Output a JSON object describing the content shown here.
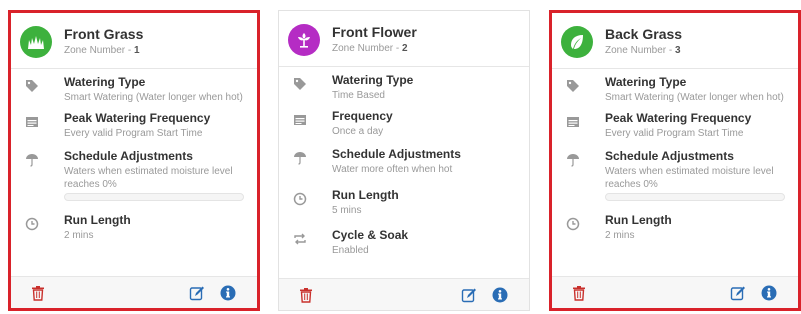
{
  "colors": {
    "selection_border": "#d9222a",
    "info_blue": "#2a6db5",
    "trash_red": "#c9302c",
    "icon_gray": "#999999"
  },
  "cards": [
    {
      "name": "Front Grass",
      "zone_label": "Zone Number - ",
      "zone_number": "1",
      "icon": "grass-icon",
      "icon_color": "#3db13d",
      "selected": true,
      "rows": [
        {
          "icon": "tag-icon",
          "title": "Watering Type",
          "value": "Smart Watering (Water longer when hot)"
        },
        {
          "icon": "calendar-icon",
          "title": "Peak Watering Frequency",
          "value": "Every valid Program Start Time"
        },
        {
          "icon": "umbrella-icon",
          "title": "Schedule Adjustments",
          "value": "Waters when estimated moisture level reaches 0%",
          "progress": 0
        },
        {
          "icon": "clock-icon",
          "title": "Run Length",
          "value": "2 mins"
        }
      ]
    },
    {
      "name": "Front Flower",
      "zone_label": "Zone Number - ",
      "zone_number": "2",
      "icon": "flower-icon",
      "icon_color": "#b52cc4",
      "selected": false,
      "rows": [
        {
          "icon": "tag-icon",
          "title": "Watering Type",
          "value": "Time Based"
        },
        {
          "icon": "calendar-icon",
          "title": "Frequency",
          "value": "Once a day"
        },
        {
          "icon": "umbrella-icon",
          "title": "Schedule Adjustments",
          "value": "Water more often when hot"
        },
        {
          "icon": "clock-icon",
          "title": "Run Length",
          "value": "5 mins"
        },
        {
          "icon": "cycle-icon",
          "title": "Cycle & Soak",
          "value": "Enabled"
        }
      ]
    },
    {
      "name": "Back Grass",
      "zone_label": "Zone Number - ",
      "zone_number": "3",
      "icon": "leaf-icon",
      "icon_color": "#3db13d",
      "selected": true,
      "rows": [
        {
          "icon": "tag-icon",
          "title": "Watering Type",
          "value": "Smart Watering (Water longer when hot)"
        },
        {
          "icon": "calendar-icon",
          "title": "Peak Watering Frequency",
          "value": "Every valid Program Start Time"
        },
        {
          "icon": "umbrella-icon",
          "title": "Schedule Adjustments",
          "value": "Waters when estimated moisture level reaches 0%",
          "progress": 0
        },
        {
          "icon": "clock-icon",
          "title": "Run Length",
          "value": "2 mins"
        }
      ]
    }
  ]
}
